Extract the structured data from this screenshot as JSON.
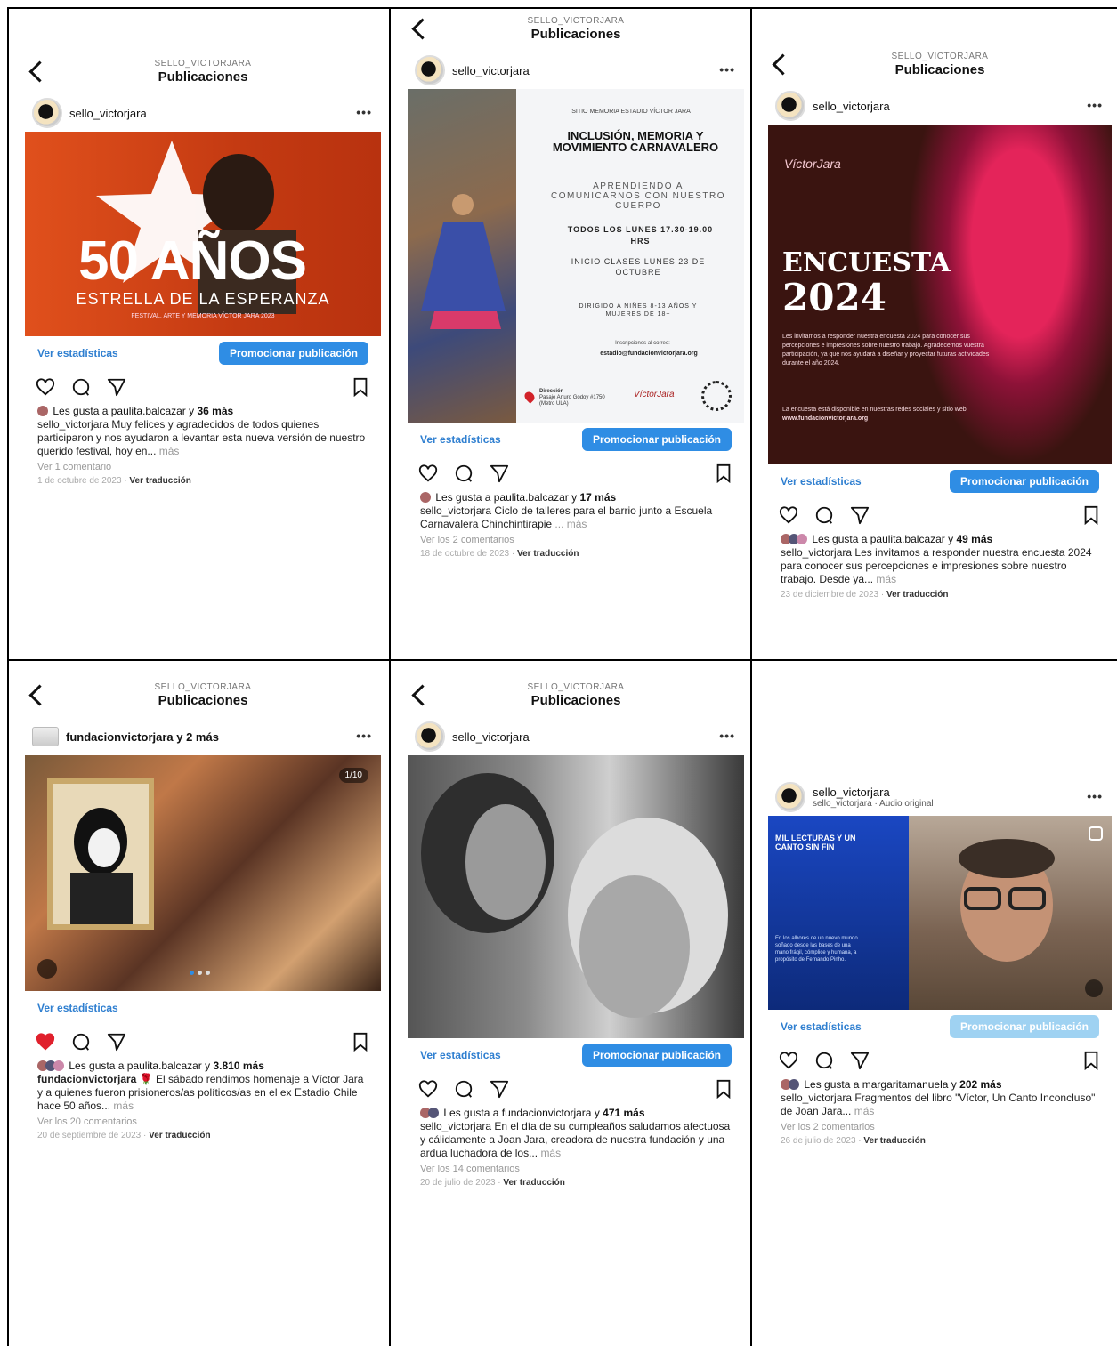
{
  "colors": {
    "accent": "#2f8de4",
    "link": "#2f7fd0",
    "liked": "#e0202c"
  },
  "posts": [
    {
      "account_small": "SELLO_VICTORJARA",
      "title": "Publicaciones",
      "handle": "sello_victorjara",
      "media": {
        "big": "50 AÑOS",
        "sub": "ESTRELLA DE LA ESPERANZA",
        "tiny": "FESTIVAL, ARTE Y MEMORIA VÍCTOR JARA 2023"
      },
      "stats_label": "Ver estadísticas",
      "promote_label": "Promocionar publicación",
      "likes_prefix": "Les gusta a",
      "likes_user": "paulita.balcazar",
      "likes_mid": "y",
      "likes_count": "36 más",
      "caption_user": "sello_victorjara",
      "caption_text": "Muy felices y agradecidos de todos quienes participaron y nos ayudaron a levantar esta nueva versión de nuestro querido festival, hoy en...",
      "more": "más",
      "comments": "Ver 1 comentario",
      "date": "1 de octubre de 2023",
      "translate": "Ver traducción"
    },
    {
      "account_small": "SELLO_VICTORJARA",
      "title": "Publicaciones",
      "handle": "sello_victorjara",
      "media": {
        "top": "SITIO MEMORIA ESTADIO VÍCTOR JARA",
        "heading": "INCLUSIÓN, MEMORIA Y MOVIMIENTO CARNAVALERO",
        "sub": "APRENDIENDO A COMUNICARNOS CON NUESTRO CUERPO",
        "when": "TODOS LOS LUNES 17.30-19.00 HRS",
        "start": "INICIO CLASES LUNES 23 DE OCTUBRE",
        "target": "DIRIGIDO A NIÑES 8-13 AÑOS Y MUJERES DE 18+",
        "contact": "Inscripciones al correo:",
        "email": "estadio@fundacionvictorjara.org",
        "dir_label": "Dirección",
        "dir_text": "Pasaje Arturo Godoy #1750 (Metro ULA)"
      },
      "stats_label": "Ver estadísticas",
      "promote_label": "Promocionar publicación",
      "likes_prefix": "Les gusta a",
      "likes_user": "paulita.balcazar",
      "likes_mid": "y",
      "likes_count": "17 más",
      "caption_user": "sello_victorjara",
      "caption_text": "Ciclo de talleres para el barrio junto a Escuela Carnavalera Chinchintirapie",
      "more": "... más",
      "comments": "Ver los 2 comentarios",
      "date": "18 de octubre de 2023",
      "translate": "Ver traducción"
    },
    {
      "account_small": "SELLO_VICTORJARA",
      "title": "Publicaciones",
      "handle": "sello_victorjara",
      "media": {
        "big1": "ENCUESTA",
        "big2": "2024",
        "logo": "VíctorJara",
        "p1": "Les invitamos a responder nuestra encuesta 2024 para conocer sus percepciones e impresiones sobre nuestro trabajo. Agradecemos vuestra participación, ya que nos ayudará a diseñar y proyectar futuras actividades durante el año 2024.",
        "p2": "La encuesta está disponible en nuestras redes sociales y sitio web:",
        "web": "www.fundacionvictorjara.org"
      },
      "stats_label": "Ver estadísticas",
      "promote_label": "Promocionar publicación",
      "likes_prefix": "Les gusta a",
      "likes_user": "paulita.balcazar",
      "likes_mid": "y",
      "likes_count": "49 más",
      "caption_user": "sello_victorjara",
      "caption_text": "Les invitamos a responder nuestra encuesta 2024 para conocer sus percepciones e impresiones sobre nuestro trabajo. Desde ya...",
      "more": "más",
      "date": "23 de diciembre de 2023",
      "translate": "Ver traducción"
    },
    {
      "account_small": "SELLO_VICTORJARA",
      "title": "Publicaciones",
      "handle": "fundacionvictorjara y 2 más",
      "media": {
        "counter": "1/10"
      },
      "stats_label": "Ver estadísticas",
      "likes_prefix": "Les gusta a",
      "likes_user": "paulita.balcazar",
      "likes_mid": "y",
      "likes_count": "3.810 más",
      "caption_user": "fundacionvictorjara",
      "caption_text": "El sábado rendimos homenaje a Víctor Jara y a quienes fueron prisioneros/as políticos/as en el ex Estadio Chile hace 50 años...",
      "more": "más",
      "comments": "Ver los 20 comentarios",
      "date": "20 de septiembre de 2023",
      "translate": "Ver traducción"
    },
    {
      "account_small": "SELLO_VICTORJARA",
      "title": "Publicaciones",
      "handle": "sello_victorjara",
      "stats_label": "Ver estadísticas",
      "promote_label": "Promocionar publicación",
      "likes_prefix": "Les gusta a",
      "likes_user": "fundacionvictorjara",
      "likes_mid": "y",
      "likes_count": "471 más",
      "caption_user": "sello_victorjara",
      "caption_text": "En el día de su cumpleaños saludamos afectuosa y cálidamente a Joan Jara, creadora de nuestra fundación y una ardua luchadora de los...",
      "more": "más",
      "comments": "Ver los 14 comentarios",
      "date": "20 de julio de 2023",
      "translate": "Ver traducción"
    },
    {
      "handle": "sello_victorjara",
      "subhandle": "sello_victorjara · Audio original",
      "media": {
        "heading": "MIL LECTURAS Y UN CANTO SIN FIN",
        "body": "En los albores de un nuevo mundo soñado desde las bases de una mano frágil, cómplice y humana, a propósito de Fernando Pinho."
      },
      "stats_label": "Ver estadísticas",
      "promote_label": "Promocionar publicación",
      "likes_prefix": "Les gusta a",
      "likes_user": "margaritamanuela",
      "likes_mid": "y",
      "likes_count": "202 más",
      "caption_user": "sello_victorjara",
      "caption_text": "Fragmentos del libro \"Víctor, Un Canto Inconcluso\" de Joan Jara...",
      "more": "más",
      "comments": "Ver los 2 comentarios",
      "date": "26 de julio de 2023",
      "translate": "Ver traducción"
    }
  ]
}
